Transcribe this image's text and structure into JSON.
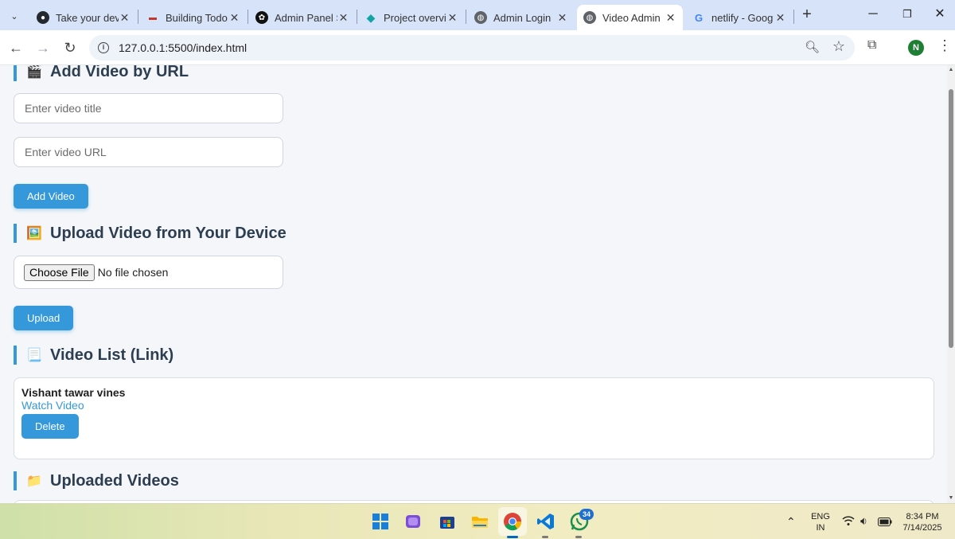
{
  "browser": {
    "tabs": [
      {
        "title": "Take your dev",
        "icon": "github-avatar-icon",
        "active": false
      },
      {
        "title": "Building Todo",
        "icon": "tab-favicon-icon",
        "active": false
      },
      {
        "title": "Admin Panel S",
        "icon": "openai-icon",
        "active": false
      },
      {
        "title": "Project overvi",
        "icon": "diamond-icon",
        "active": false
      },
      {
        "title": "Admin Login",
        "icon": "globe-icon",
        "active": false
      },
      {
        "title": "Video Admin",
        "icon": "globe-icon",
        "active": true
      },
      {
        "title": "netlify - Goog",
        "icon": "google-icon",
        "active": false
      }
    ],
    "url": "127.0.0.1:5500/index.html",
    "profile_initial": "N"
  },
  "page": {
    "add_section": {
      "heading": "Add Video by URL",
      "emoji": "🎬",
      "title_placeholder": "Enter video title",
      "url_placeholder": "Enter video URL",
      "button_label": "Add Video"
    },
    "upload_section": {
      "heading": "Upload Video from Your Device",
      "emoji": "🖼️",
      "choose_file_label": "Choose File",
      "no_file_text": "No file chosen",
      "button_label": "Upload"
    },
    "list_section": {
      "heading": "Video List (Link)",
      "emoji": "📃",
      "videos": [
        {
          "title": "Vishant tawar vines",
          "link_text": "Watch Video",
          "delete_label": "Delete"
        }
      ]
    },
    "uploaded_section": {
      "heading": "Uploaded Videos",
      "emoji": "📁"
    }
  },
  "taskbar": {
    "apps": [
      "windows-start-icon",
      "files-app-icon",
      "store-icon",
      "file-explorer-icon",
      "chrome-icon",
      "vscode-icon",
      "whatsapp-icon"
    ],
    "whatsapp_badge": "34",
    "language": "ENG",
    "region": "IN",
    "time": "8:34 PM",
    "date": "7/14/2025"
  },
  "colors": {
    "accent": "#3498db",
    "heading": "#2c3e50",
    "tabstrip": "#d7e3f8"
  }
}
